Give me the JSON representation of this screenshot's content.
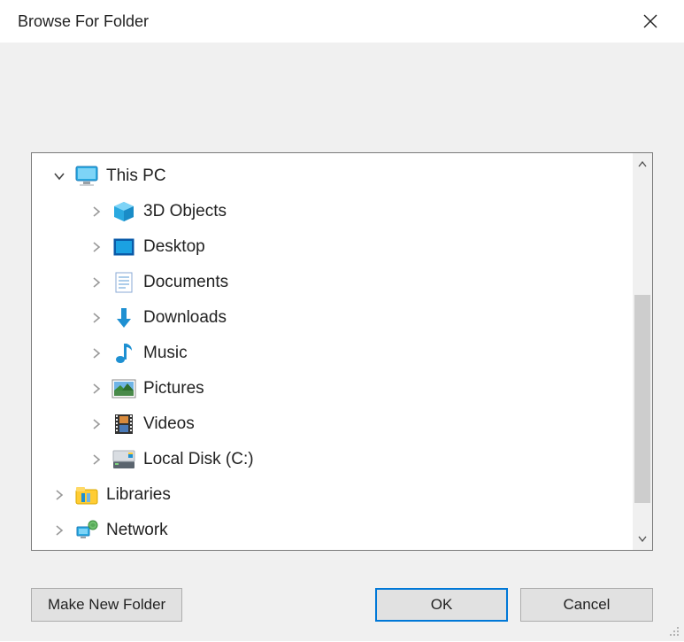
{
  "title": "Browse For Folder",
  "tree": {
    "root": {
      "label": "This PC",
      "expanded": true,
      "children": [
        {
          "label": "3D Objects",
          "icon": "objects3d"
        },
        {
          "label": "Desktop",
          "icon": "desktop"
        },
        {
          "label": "Documents",
          "icon": "documents"
        },
        {
          "label": "Downloads",
          "icon": "downloads"
        },
        {
          "label": "Music",
          "icon": "music"
        },
        {
          "label": "Pictures",
          "icon": "pictures"
        },
        {
          "label": "Videos",
          "icon": "videos"
        },
        {
          "label": "Local Disk (C:)",
          "icon": "disk"
        }
      ]
    },
    "siblings": [
      {
        "label": "Libraries",
        "icon": "libraries"
      },
      {
        "label": "Network",
        "icon": "network"
      }
    ]
  },
  "buttons": {
    "makeNew": "Make New Folder",
    "ok": "OK",
    "cancel": "Cancel"
  }
}
